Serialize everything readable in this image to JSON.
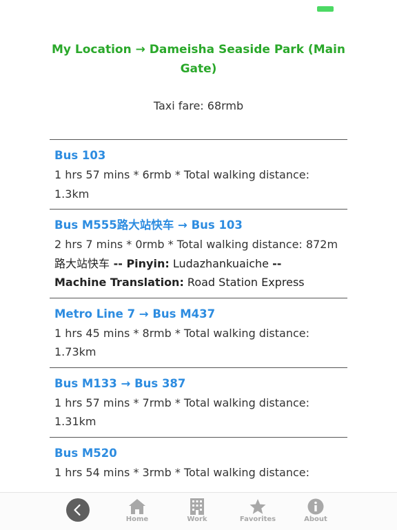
{
  "header": {
    "route_title": "My Location → Dameisha Seaside Park (Main Gate)",
    "taxi_fare": "Taxi fare: 68rmb"
  },
  "results": [
    {
      "title": "Bus 103",
      "info": "1 hrs 57 mins * 6rmb * Total walking distance: 1.3km"
    },
    {
      "title": "Bus M555路大站快车 → Bus 103",
      "info": "2 hrs 7 mins * 0rmb * Total walking distance: 872m",
      "note": {
        "original": "路大站快车",
        "separator1": " -- ",
        "pinyin_label": "Pinyin:",
        "pinyin": " Ludazhankuaiche ",
        "separator2": "--",
        "mt_label": "Machine Translation:",
        "translation": " Road Station Express"
      }
    },
    {
      "title": "Metro Line 7 → Bus M437",
      "info": "1 hrs 45 mins * 8rmb * Total walking distance: 1.73km"
    },
    {
      "title": "Bus M133 → Bus 387",
      "info": "1 hrs 57 mins * 7rmb * Total walking distance: 1.31km"
    },
    {
      "title": "Bus M520",
      "info": "1 hrs 54 mins * 3rmb * Total walking distance:"
    }
  ],
  "tabbar": {
    "back_icon": "chevron-left-icon",
    "home": "Home",
    "work": "Work",
    "favorites": "Favorites",
    "about": "About"
  },
  "colors": {
    "route_title": "#2aa82a",
    "link_blue": "#2d8ce0",
    "tab_gray": "#a8a8a8",
    "status_green": "#4cd964"
  }
}
